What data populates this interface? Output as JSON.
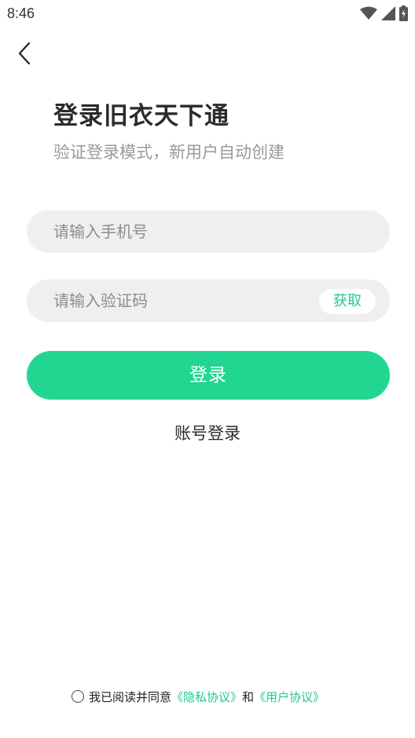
{
  "status_bar": {
    "time": "8:46",
    "icons": [
      "wifi-icon",
      "cell-signal-icon",
      "battery-charging-icon"
    ]
  },
  "nav": {
    "back_icon": "chevron-left-icon"
  },
  "header": {
    "title": "登录旧衣天下通",
    "subtitle": "验证登录模式，新用户自动创建"
  },
  "form": {
    "phone": {
      "placeholder": "请输入手机号",
      "value": ""
    },
    "code": {
      "placeholder": "请输入验证码",
      "value": "",
      "get_code_label": "获取"
    },
    "login_label": "登录",
    "account_login_label": "账号登录"
  },
  "agreement": {
    "checked": false,
    "prefix": "我已阅读并同意",
    "privacy_link": "《隐私协议》",
    "conjunction": "和",
    "user_link": "《用户协议》"
  },
  "colors": {
    "accent": "#22d691",
    "link": "#22c98a",
    "field_bg": "#efefef"
  }
}
